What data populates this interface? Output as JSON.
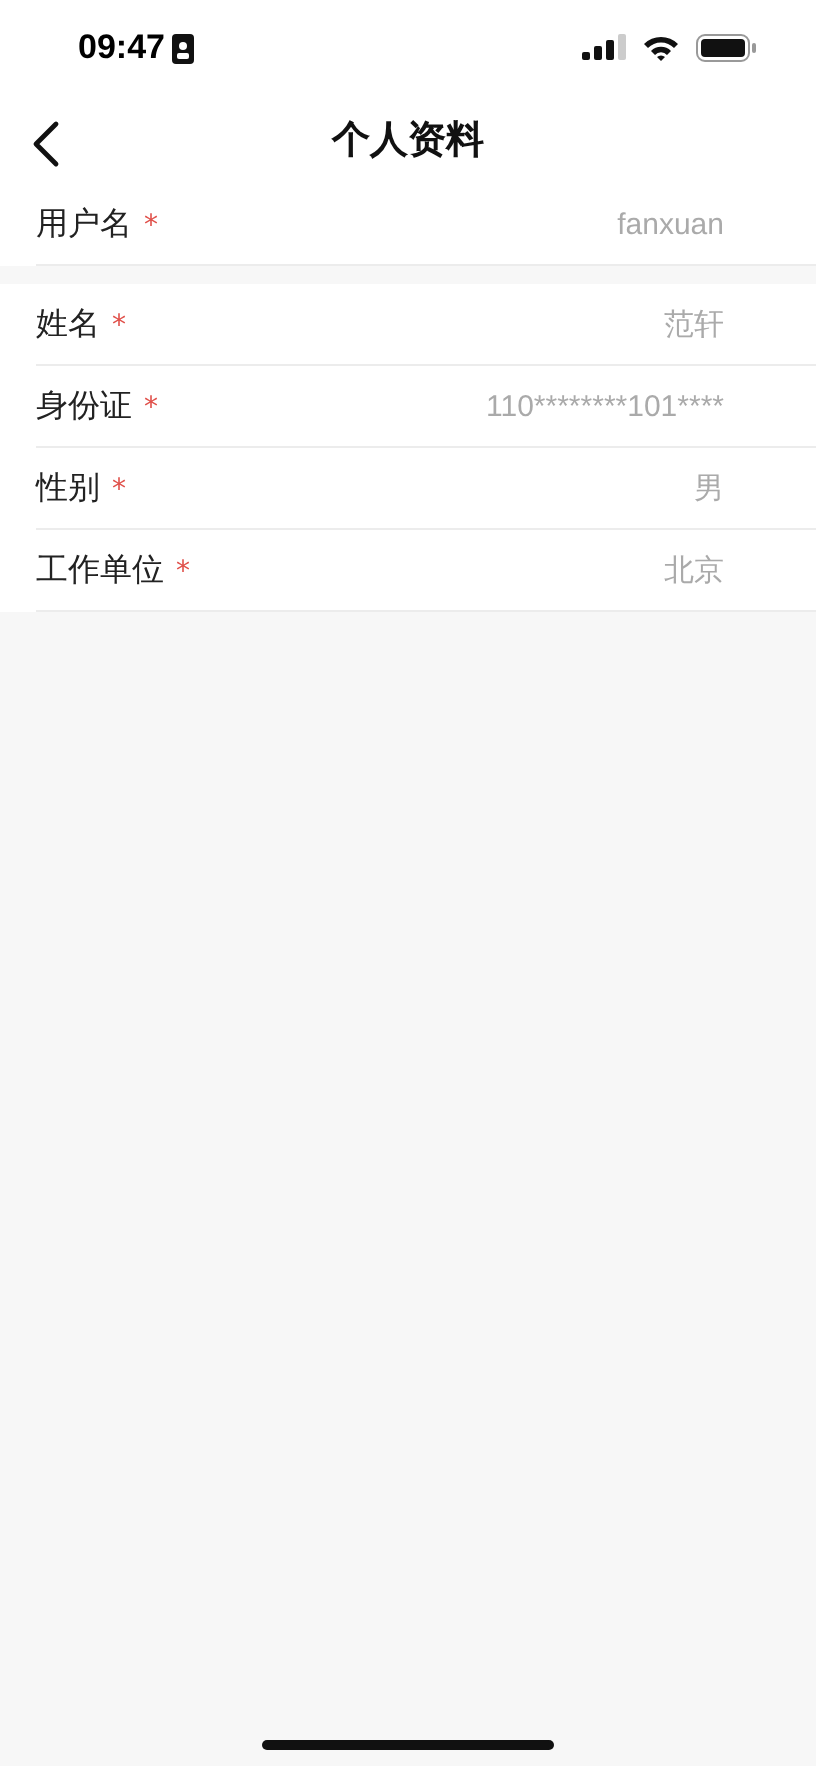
{
  "status_bar": {
    "time": "09:47"
  },
  "nav": {
    "title": "个人资料"
  },
  "sections": [
    {
      "fields": [
        {
          "label": "用户名",
          "required_mark": "*",
          "value": "fanxuan"
        }
      ]
    },
    {
      "fields": [
        {
          "label": "姓名",
          "required_mark": "*",
          "value": "范轩"
        },
        {
          "label": "身份证",
          "required_mark": "*",
          "value": "110********101****"
        },
        {
          "label": "性别",
          "required_mark": "*",
          "value": "男"
        },
        {
          "label": "工作单位",
          "required_mark": "*",
          "value": "北京"
        }
      ]
    }
  ]
}
